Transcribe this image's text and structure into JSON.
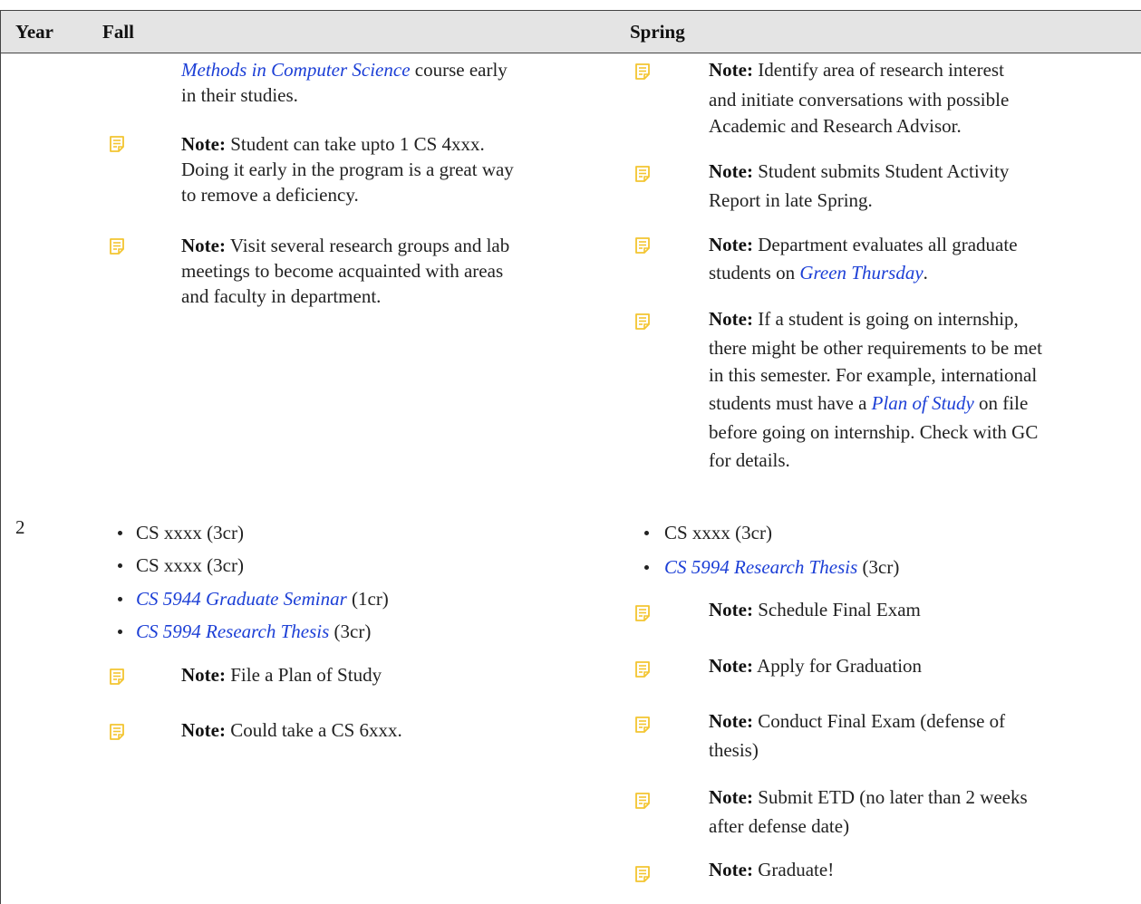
{
  "header": {
    "year": "Year",
    "fall": "Fall",
    "spring": "Spring"
  },
  "row1": {
    "fall": {
      "lead": {
        "link": "Methods in Computer Science",
        "text1": " course early",
        "text2": "in their studies."
      },
      "notes": [
        {
          "label": "Note:",
          "lines": [
            "  Student can take upto 1 CS 4xxx.",
            "Doing it early in the program is a great way",
            "to remove a deficiency."
          ]
        },
        {
          "label": "Note:",
          "lines": [
            "  Visit several research groups and lab",
            "meetings to become acquainted with areas",
            "and faculty in department."
          ]
        }
      ]
    },
    "spring": {
      "notes": [
        {
          "label": "Note:",
          "lines": [
            "  Identify area of research interest",
            "and initiate conversations with possible",
            "Academic and Research Advisor."
          ]
        },
        {
          "label": "Note:",
          "lines": [
            "  Student submits Student Activity",
            "Report in late Spring."
          ]
        },
        {
          "label": "Note:",
          "lines": [
            "  Department evaluates all graduate"
          ],
          "line2_pre": "students on ",
          "line2_link": "Green Thursday",
          "line2_post": "."
        },
        {
          "label": "Note:",
          "lines": [
            "  If a student is going on internship,",
            "there might be other requirements to be met",
            "in this semester. For example, international"
          ],
          "line4_pre": "students must have a ",
          "line4_link": "Plan of Study",
          "line4_post": " on file",
          "lines_after": [
            "before going on internship. Check with GC",
            "for details."
          ]
        }
      ]
    }
  },
  "row2": {
    "year": "2",
    "fall": {
      "items": [
        {
          "text": "CS xxxx (3cr)"
        },
        {
          "text": "CS xxxx (3cr)"
        },
        {
          "link": "CS 5944 Graduate Seminar",
          "text": " (1cr)"
        },
        {
          "link": "CS 5994 Research Thesis",
          "text": " (3cr)"
        }
      ],
      "notes": [
        {
          "label": "Note:",
          "lines": [
            "  File a Plan of Study"
          ]
        },
        {
          "label": "Note:",
          "lines": [
            "  Could take a CS 6xxx."
          ]
        }
      ]
    },
    "spring": {
      "items": [
        {
          "text": "CS xxxx (3cr)"
        },
        {
          "link": "CS 5994 Research Thesis",
          "text": " (3cr)"
        }
      ],
      "notes": [
        {
          "label": "Note:",
          "lines": [
            "  Schedule Final Exam"
          ]
        },
        {
          "label": "Note:",
          "lines": [
            "  Apply for Graduation"
          ]
        },
        {
          "label": "Note:",
          "lines": [
            "  Conduct Final Exam (defense of",
            "thesis)"
          ]
        },
        {
          "label": "Note:",
          "lines": [
            "  Submit ETD (no later than 2 weeks",
            "after defense date)"
          ]
        },
        {
          "label": "Note:",
          "lines": [
            "  Graduate!"
          ]
        }
      ]
    }
  },
  "colors": {
    "link": "#1c3fd6",
    "note_icon": "#f3c530",
    "header_bg": "#e4e4e4"
  },
  "icons": {
    "note": "note-icon"
  }
}
